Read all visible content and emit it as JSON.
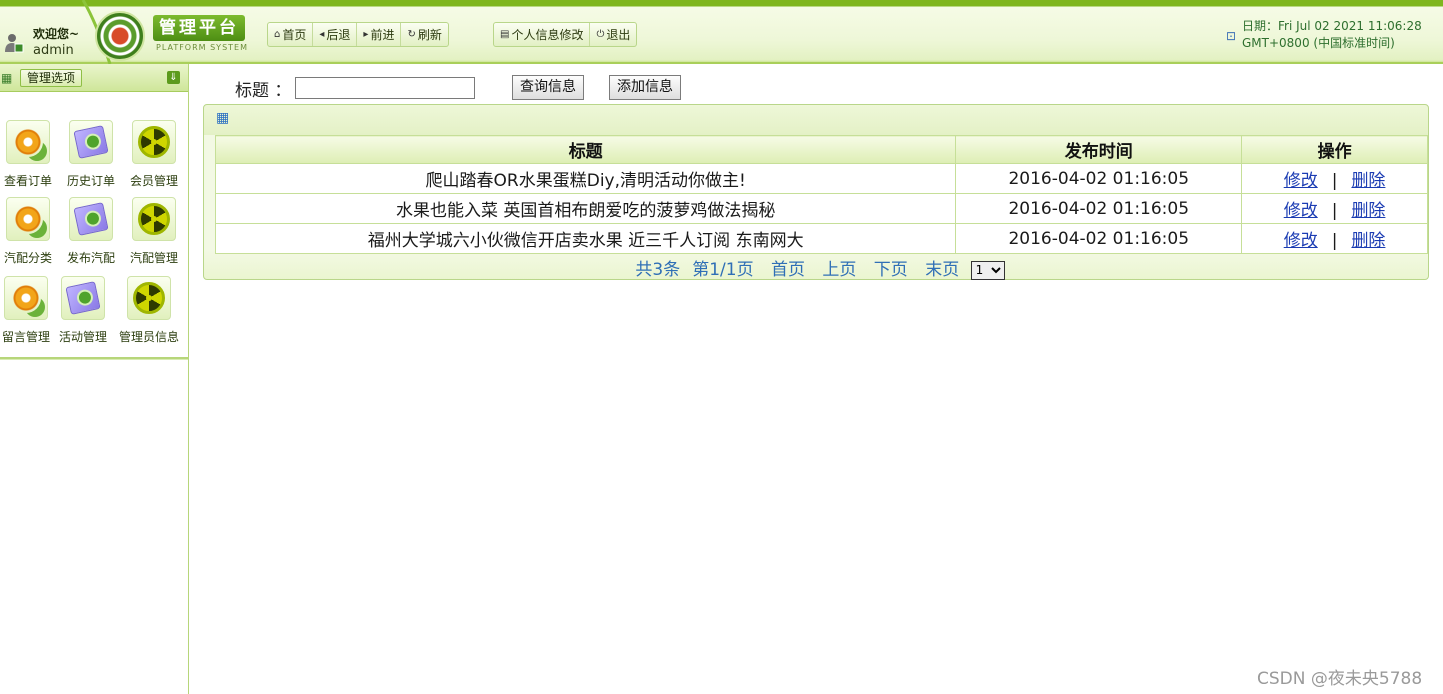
{
  "header": {
    "welcome": "欢迎您~",
    "username": "admin",
    "logo_title": "管理平台",
    "logo_subtitle": "PLATFORM SYSTEM",
    "nav": [
      "首页",
      "后退",
      "前进",
      "刷新"
    ],
    "actions": [
      "个人信息修改",
      "退出"
    ],
    "date_line1": "日期：Fri Jul 02 2021 11:06:28",
    "date_line2": "GMT+0800 (中国标准时间)"
  },
  "sidebar": {
    "title": "管理选项",
    "items": [
      {
        "label": "查看订单",
        "icon": "gear-icon"
      },
      {
        "label": "历史订单",
        "icon": "pencil-icon"
      },
      {
        "label": "会员管理",
        "icon": "radiation-icon"
      },
      {
        "label": "汽配分类",
        "icon": "gear-icon"
      },
      {
        "label": "发布汽配",
        "icon": "pencil-icon"
      },
      {
        "label": "汽配管理",
        "icon": "radiation-icon"
      },
      {
        "label": "留言管理",
        "icon": "gear-icon"
      },
      {
        "label": "活动管理",
        "icon": "pencil-icon"
      },
      {
        "label": "管理员信息",
        "icon": "radiation-icon"
      }
    ]
  },
  "search": {
    "label": "标题 ：",
    "value": "",
    "query_button": "查询信息",
    "add_button": "添加信息"
  },
  "table": {
    "columns": [
      "标题",
      "发布时间",
      "操作"
    ],
    "rows": [
      {
        "title": "爬山踏春OR水果蛋糕Diy,清明活动你做主!",
        "time": "2016-04-02 01:16:05"
      },
      {
        "title": "水果也能入菜 英国首相布朗爱吃的菠萝鸡做法揭秘",
        "time": "2016-04-02 01:16:05"
      },
      {
        "title": "福州大学城六小伙微信开店卖水果 近三千人订阅 东南网大",
        "time": "2016-04-02 01:16:05"
      }
    ],
    "edit_label": "修改",
    "separator": "|",
    "delete_label": "删除"
  },
  "pager": {
    "total": "共3条",
    "page_info": "第1/1页",
    "first": "首页",
    "prev": "上页",
    "next": "下页",
    "last": "末页",
    "selected_page": "1"
  },
  "watermark": "CSDN @夜未央5788"
}
